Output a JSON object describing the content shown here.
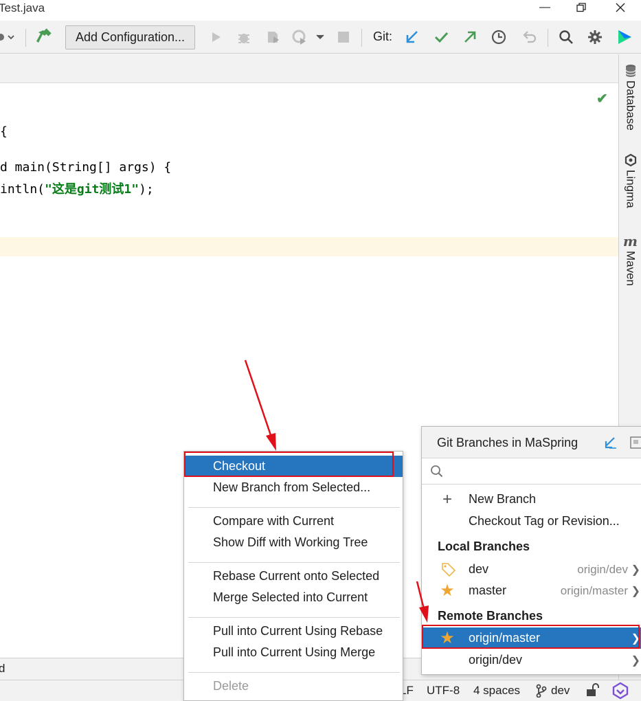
{
  "window": {
    "title": "Test.java"
  },
  "toolbar": {
    "add_configuration": "Add Configuration...",
    "git_label": "Git:"
  },
  "editor": {
    "lines": [
      "{",
      "d main(String[] args) {",
      "intln(",
      "\"这是git测试1\"",
      ");"
    ]
  },
  "right_strip": {
    "tabs": [
      {
        "label": "Database",
        "icon": "database-icon"
      },
      {
        "label": "Lingma",
        "icon": "lingma-icon"
      },
      {
        "label": "Maven",
        "icon": "maven-icon"
      }
    ]
  },
  "bottom_panel": {
    "text": "d"
  },
  "status_bar": {
    "line_sep": "LF",
    "encoding": "UTF-8",
    "indent": "4 spaces",
    "branch": "dev"
  },
  "context_menu": {
    "items": [
      {
        "label": "Checkout",
        "selected": true
      },
      {
        "label": "New Branch from Selected..."
      },
      {
        "label": "Compare with Current"
      },
      {
        "label": "Show Diff with Working Tree"
      },
      {
        "label": "Rebase Current onto Selected"
      },
      {
        "label": "Merge Selected into Current"
      },
      {
        "label": "Pull into Current Using Rebase"
      },
      {
        "label": "Pull into Current Using Merge"
      },
      {
        "label": "Delete",
        "disabled": true
      }
    ]
  },
  "branches_popup": {
    "title": "Git Branches in MaSpring",
    "actions": [
      "New Branch",
      "Checkout Tag or Revision..."
    ],
    "local_header": "Local Branches",
    "local": [
      {
        "name": "dev",
        "tracking": "origin/dev",
        "icon": "tag-icon"
      },
      {
        "name": "master",
        "tracking": "origin/master",
        "icon": "star-icon"
      }
    ],
    "remote_header": "Remote Branches",
    "remote": [
      {
        "name": "origin/master",
        "icon": "star-icon",
        "selected": true
      },
      {
        "name": "origin/dev"
      }
    ]
  },
  "colors": {
    "selection": "#2675bf",
    "highlight_red": "#e0101a",
    "string_green": "#067d17"
  }
}
